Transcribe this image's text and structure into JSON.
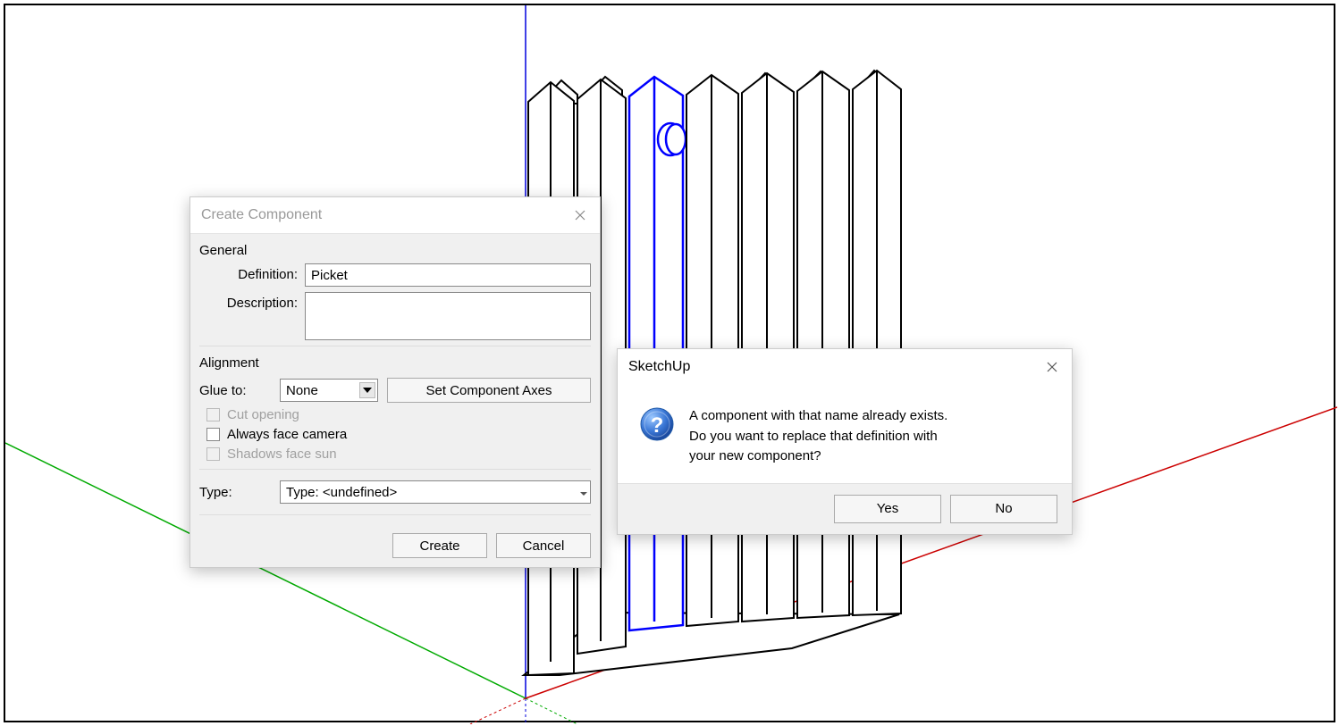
{
  "dialog1": {
    "title": "Create Component",
    "sections": {
      "general_label": "General",
      "definition_label": "Definition:",
      "definition_value": "Picket",
      "description_label": "Description:",
      "description_value": "",
      "alignment_label": "Alignment",
      "glue_to_label": "Glue to:",
      "glue_to_value": "None",
      "set_axes_label": "Set Component Axes",
      "cut_opening_label": "Cut opening",
      "always_face_label": "Always face camera",
      "shadows_face_label": "Shadows face sun",
      "type_label": "Type:",
      "type_value": "Type: <undefined>",
      "create_btn": "Create",
      "cancel_btn": "Cancel"
    }
  },
  "dialog2": {
    "title": "SketchUp",
    "message_line1": "A component with that name already exists.",
    "message_line2": "Do you want to replace that definition with",
    "message_line3": "your new component?",
    "yes_btn": "Yes",
    "no_btn": "No"
  }
}
